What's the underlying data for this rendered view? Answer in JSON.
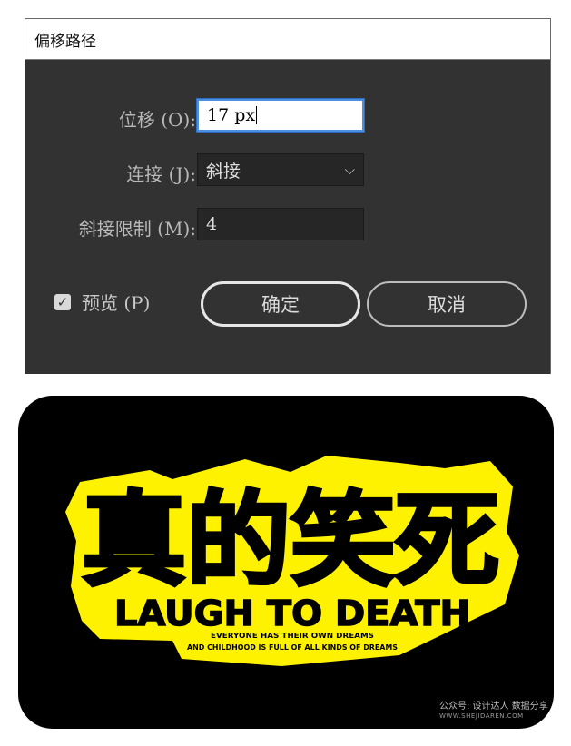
{
  "dialog": {
    "title": "偏移路径",
    "offset": {
      "label": "位移 (O):",
      "value": "17 px"
    },
    "join": {
      "label": "连接 (J):",
      "value": "斜接"
    },
    "miter_limit": {
      "label": "斜接限制 (M):",
      "value": "4"
    },
    "preview": {
      "label": "预览 (P)",
      "checked": true
    },
    "ok_label": "确定",
    "cancel_label": "取消"
  },
  "poster": {
    "headline_cn": "真的笑死",
    "headline_en": "LAUGH TO DEATH",
    "sub_line1": "EVERYONE HAS THEIR OWN DREAMS",
    "sub_line2": "AND CHILDHOOD IS FULL OF ALL KINDS OF DREAMS",
    "accent_color": "#fff200"
  },
  "watermark": {
    "line1": "公众号: 设计达人  数据分享",
    "line2": "WWW.SHEJIDAREN.COM"
  }
}
